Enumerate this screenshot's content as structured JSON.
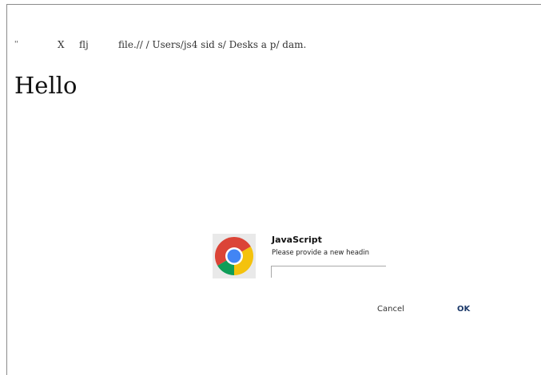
{
  "address_bar": {
    "quote_mark": "''",
    "close_glyph": "X",
    "tab_fragment": "flj",
    "url": "file.// / Users/js4  sid s/ Desks a p/ dam."
  },
  "page": {
    "heading": "Hello"
  },
  "dialog": {
    "title": "JavaScript",
    "message": "Please provide a new headin",
    "input_value": "",
    "cancel_label": "Cancel",
    "ok_label": "OK",
    "icon": "chrome-logo-icon"
  },
  "colors": {
    "background": "#ffffff",
    "ok_text": "#1d3a6a",
    "chrome_red": "#db4437",
    "chrome_yellow": "#f4c20d",
    "chrome_green": "#0f9d58",
    "chrome_blue": "#4285f4"
  }
}
